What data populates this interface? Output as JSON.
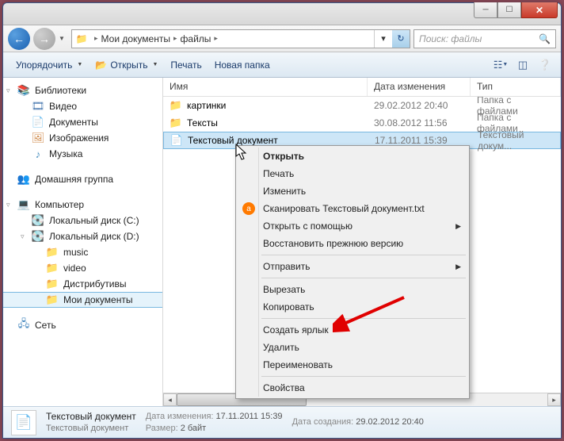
{
  "address": {
    "segments": [
      "Мои документы",
      "файлы"
    ],
    "search_placeholder": "Поиск: файлы"
  },
  "toolbar": {
    "organize": "Упорядочить",
    "open": "Открыть",
    "print": "Печать",
    "new_folder": "Новая папка"
  },
  "sidebar": {
    "libraries": "Библиотеки",
    "video": "Видео",
    "documents": "Документы",
    "images": "Изображения",
    "music": "Музыка",
    "homegroup": "Домашняя группа",
    "computer": "Компьютер",
    "disk_c": "Локальный диск (C:)",
    "disk_d": "Локальный диск (D:)",
    "music_folder": "music",
    "video_folder": "video",
    "distrib": "Дистрибутивы",
    "mydocs": "Мои документы",
    "network": "Сеть"
  },
  "columns": {
    "name": "Имя",
    "date": "Дата изменения",
    "type": "Тип"
  },
  "files": [
    {
      "name": "картинки",
      "date": "29.02.2012 20:40",
      "type": "Папка с файлами",
      "icon": "folder"
    },
    {
      "name": "Тексты",
      "date": "30.08.2012 11:56",
      "type": "Папка с файлами",
      "icon": "folder"
    },
    {
      "name": "Текстовый документ",
      "date": "17.11.2011 15:39",
      "type": "Текстовый докум...",
      "icon": "txt",
      "selected": true
    }
  ],
  "context_menu": {
    "open": "Открыть",
    "print": "Печать",
    "edit": "Изменить",
    "scan": "Сканировать Текстовый документ.txt",
    "openwith": "Открыть с помощью",
    "restore": "Восстановить прежнюю версию",
    "sendto": "Отправить",
    "cut": "Вырезать",
    "copy": "Копировать",
    "shortcut": "Создать ярлык",
    "delete": "Удалить",
    "rename": "Переименовать",
    "properties": "Свойства"
  },
  "status": {
    "title": "Текстовый документ",
    "subtitle": "Текстовый документ",
    "date_mod_label": "Дата изменения:",
    "date_mod": "17.11.2011 15:39",
    "size_label": "Размер:",
    "size": "2 байт",
    "date_created_label": "Дата создания:",
    "date_created": "29.02.2012 20:40"
  }
}
